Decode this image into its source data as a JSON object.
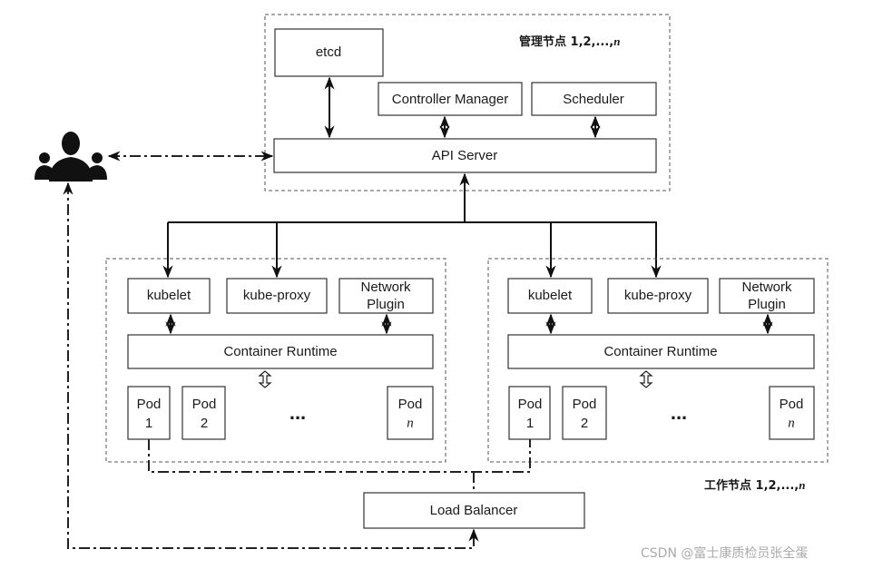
{
  "master": {
    "label": "管理节点 1,2,...,",
    "label_n": "n",
    "etcd": "etcd",
    "controller_manager": "Controller Manager",
    "scheduler": "Scheduler",
    "api_server": "API Server"
  },
  "workers": [
    {
      "kubelet": "kubelet",
      "kube_proxy": "kube-proxy",
      "network_plugin_1": "Network",
      "network_plugin_2": "Plugin",
      "container_runtime": "Container Runtime",
      "pods": [
        {
          "name": "Pod",
          "index": "1"
        },
        {
          "name": "Pod",
          "index": "2"
        },
        {
          "name": "Pod",
          "index": "n"
        }
      ],
      "ellipsis": "..."
    },
    {
      "kubelet": "kubelet",
      "kube_proxy": "kube-proxy",
      "network_plugin_1": "Network",
      "network_plugin_2": "Plugin",
      "container_runtime": "Container Runtime",
      "pods": [
        {
          "name": "Pod",
          "index": "1"
        },
        {
          "name": "Pod",
          "index": "2"
        },
        {
          "name": "Pod",
          "index": "n"
        }
      ],
      "ellipsis": "..."
    }
  ],
  "worker_label": "工作节点 1,2,...,",
  "worker_label_n": "n",
  "load_balancer": "Load Balancer",
  "users_icon": "users-icon",
  "watermark": "CSDN @富士康质检员张全蛋"
}
